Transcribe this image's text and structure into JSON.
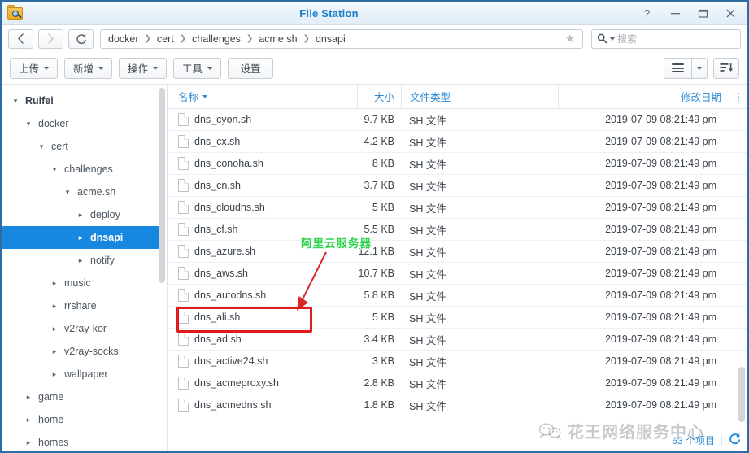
{
  "window": {
    "title": "File Station",
    "app_icon": "folder-search-icon",
    "controls": [
      {
        "name": "help-button",
        "glyph": "?"
      },
      {
        "name": "minimize-button",
        "glyph": "—"
      },
      {
        "name": "maximize-button",
        "glyph": "▭"
      },
      {
        "name": "close-button",
        "glyph": "✕"
      }
    ]
  },
  "nav": {
    "back_label": "‹",
    "forward_label": "›",
    "refresh_label": "⟳",
    "breadcrumb": [
      "docker",
      "cert",
      "challenges",
      "acme.sh",
      "dnsapi"
    ],
    "breadcrumb_separator": "❯",
    "favorite_icon": "star-icon",
    "search": {
      "icon": "search-icon",
      "placeholder": "搜索",
      "value": ""
    }
  },
  "toolbar": {
    "buttons": [
      {
        "label": "上传",
        "has_menu": true,
        "name": "upload-button"
      },
      {
        "label": "新增",
        "has_menu": true,
        "name": "create-button"
      },
      {
        "label": "操作",
        "has_menu": true,
        "name": "action-button"
      },
      {
        "label": "工具",
        "has_menu": true,
        "name": "tools-button"
      },
      {
        "label": "设置",
        "has_menu": false,
        "name": "settings-button"
      }
    ],
    "view_button": "list-view-icon",
    "view_menu": "chevron-down-icon",
    "sort_button": "sort-descending-icon"
  },
  "sidebar": {
    "items": [
      {
        "label": "Ruifei",
        "depth": 0,
        "expanded": true,
        "selected": false,
        "root": true
      },
      {
        "label": "docker",
        "depth": 1,
        "expanded": true,
        "selected": false
      },
      {
        "label": "cert",
        "depth": 2,
        "expanded": true,
        "selected": false
      },
      {
        "label": "challenges",
        "depth": 3,
        "expanded": true,
        "selected": false
      },
      {
        "label": "acme.sh",
        "depth": 4,
        "expanded": true,
        "selected": false
      },
      {
        "label": "deploy",
        "depth": 5,
        "expanded": false,
        "selected": false
      },
      {
        "label": "dnsapi",
        "depth": 5,
        "expanded": false,
        "selected": true
      },
      {
        "label": "notify",
        "depth": 5,
        "expanded": false,
        "selected": false
      },
      {
        "label": "music",
        "depth": 3,
        "expanded": false,
        "selected": false
      },
      {
        "label": "rrshare",
        "depth": 3,
        "expanded": false,
        "selected": false
      },
      {
        "label": "v2ray-kor",
        "depth": 3,
        "expanded": false,
        "selected": false
      },
      {
        "label": "v2ray-socks",
        "depth": 3,
        "expanded": false,
        "selected": false
      },
      {
        "label": "wallpaper",
        "depth": 3,
        "expanded": false,
        "selected": false
      },
      {
        "label": "game",
        "depth": 1,
        "expanded": false,
        "selected": false
      },
      {
        "label": "home",
        "depth": 1,
        "expanded": false,
        "selected": false
      },
      {
        "label": "homes",
        "depth": 1,
        "expanded": false,
        "selected": false
      }
    ],
    "expand_glyph": "▾",
    "collapse_glyph": "▸"
  },
  "filelist": {
    "columns": [
      {
        "key": "name",
        "label": "名称",
        "sorted": true
      },
      {
        "key": "size",
        "label": "大小"
      },
      {
        "key": "type",
        "label": "文件类型"
      },
      {
        "key": "date",
        "label": "修改日期"
      }
    ],
    "column_menu_icon": "more-vertical-icon",
    "rows": [
      {
        "name": "dns_cyon.sh",
        "size": "9.7 KB",
        "type": "SH 文件",
        "date": "2019-07-09 08:21:49 pm"
      },
      {
        "name": "dns_cx.sh",
        "size": "4.2 KB",
        "type": "SH 文件",
        "date": "2019-07-09 08:21:49 pm"
      },
      {
        "name": "dns_conoha.sh",
        "size": "8 KB",
        "type": "SH 文件",
        "date": "2019-07-09 08:21:49 pm"
      },
      {
        "name": "dns_cn.sh",
        "size": "3.7 KB",
        "type": "SH 文件",
        "date": "2019-07-09 08:21:49 pm"
      },
      {
        "name": "dns_cloudns.sh",
        "size": "5 KB",
        "type": "SH 文件",
        "date": "2019-07-09 08:21:49 pm"
      },
      {
        "name": "dns_cf.sh",
        "size": "5.5 KB",
        "type": "SH 文件",
        "date": "2019-07-09 08:21:49 pm"
      },
      {
        "name": "dns_azure.sh",
        "size": "12.1 KB",
        "type": "SH 文件",
        "date": "2019-07-09 08:21:49 pm"
      },
      {
        "name": "dns_aws.sh",
        "size": "10.7 KB",
        "type": "SH 文件",
        "date": "2019-07-09 08:21:49 pm"
      },
      {
        "name": "dns_autodns.sh",
        "size": "5.8 KB",
        "type": "SH 文件",
        "date": "2019-07-09 08:21:49 pm"
      },
      {
        "name": "dns_ali.sh",
        "size": "5 KB",
        "type": "SH 文件",
        "date": "2019-07-09 08:21:49 pm"
      },
      {
        "name": "dns_ad.sh",
        "size": "3.4 KB",
        "type": "SH 文件",
        "date": "2019-07-09 08:21:49 pm"
      },
      {
        "name": "dns_active24.sh",
        "size": "3 KB",
        "type": "SH 文件",
        "date": "2019-07-09 08:21:49 pm"
      },
      {
        "name": "dns_acmeproxy.sh",
        "size": "2.8 KB",
        "type": "SH 文件",
        "date": "2019-07-09 08:21:49 pm"
      },
      {
        "name": "dns_acmedns.sh",
        "size": "1.8 KB",
        "type": "SH 文件",
        "date": "2019-07-09 08:21:49 pm"
      }
    ]
  },
  "statusbar": {
    "item_count": "63 个项目",
    "refresh_icon": "refresh-icon"
  },
  "annotations": {
    "callout_text": "阿里云服务器",
    "callout_color": "#2fd44f",
    "highlight_color": "#e01b1b",
    "arrow_color": "#d62828"
  },
  "watermark": {
    "text": "花王网络服务中心",
    "icon": "wechat-icon"
  }
}
